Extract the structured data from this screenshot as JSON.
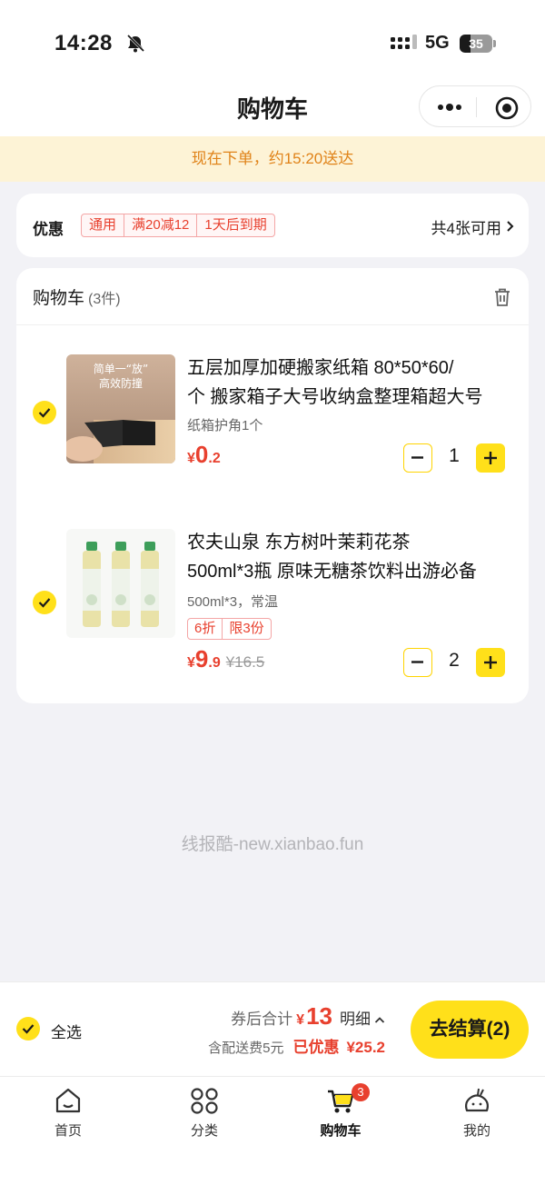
{
  "status_bar": {
    "time": "14:28",
    "network": "5G",
    "battery": "35"
  },
  "nav": {
    "title": "购物车"
  },
  "notice": {
    "text": "现在下单，约15:20送达"
  },
  "coupon": {
    "label": "优惠",
    "tags": [
      "通用",
      "满20减12",
      "1天后到期"
    ],
    "available": "共4张可用"
  },
  "cart": {
    "title": "购物车",
    "count": "(3件)",
    "items": [
      {
        "name_line1": "五层加厚加硬搬家纸箱 80*50*60/",
        "name_line2": "个 搬家箱子大号收纳盒整理箱超大号",
        "thumb_text1": "简单一“放”",
        "thumb_text2": "高效防撞",
        "spec": "纸箱护角1个",
        "price_symbol": "¥",
        "price_int": "0",
        "price_dec": ".2",
        "quantity": "1"
      },
      {
        "name_line1": "农夫山泉 东方树叶茉莉花茶",
        "name_line2": "500ml*3瓶 原味无糖茶饮料出游必备",
        "spec": "500ml*3，常温",
        "badges": [
          "6折",
          "限3份"
        ],
        "price_symbol": "¥",
        "price_int": "9",
        "price_dec": ".9",
        "original_price": "¥16.5",
        "quantity": "2"
      }
    ]
  },
  "watermark": "线报酷-new.xianbao.fun",
  "checkout": {
    "select_all": "全选",
    "total_label": "券后合计",
    "currency": "¥",
    "total": "13",
    "detail": "明细",
    "shipping": "含配送费5元",
    "saved_label": "已优惠",
    "saved": "¥25.2",
    "button": "去结算(2)"
  },
  "tabbar": [
    {
      "label": "首页",
      "icon": "home-icon"
    },
    {
      "label": "分类",
      "icon": "category-icon"
    },
    {
      "label": "购物车",
      "icon": "cart-icon",
      "badge": "3",
      "active": true
    },
    {
      "label": "我的",
      "icon": "profile-icon"
    }
  ],
  "colors": {
    "accent": "#ffe01a",
    "price": "#e8402e",
    "notice_bg": "#fdf3d6",
    "notice_text": "#e08319"
  }
}
